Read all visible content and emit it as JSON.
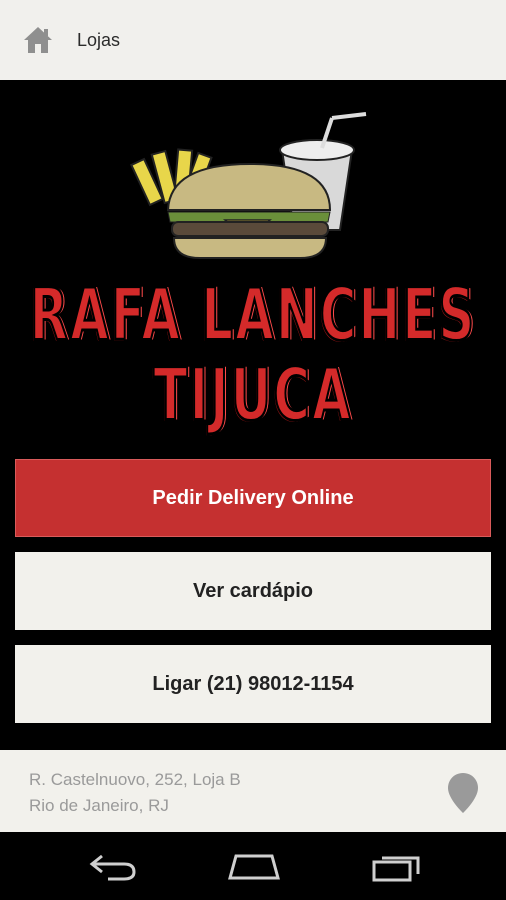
{
  "topbar": {
    "title": "Lojas",
    "icon": "home-icon"
  },
  "logo": {
    "line1": "RAFA LANCHES",
    "line2": "TIJUCA",
    "image": "burger-fries-drink-illustration"
  },
  "buttons": {
    "delivery": "Pedir Delivery Online",
    "menu": "Ver cardápio",
    "call": "Ligar (21) 98012-1154"
  },
  "address": {
    "line1": "R. Castelnuovo, 252, Loja B",
    "line2": "Rio de Janeiro, RJ",
    "icon": "map-pin-icon"
  },
  "navbar": {
    "icons": [
      "back-icon",
      "home-icon",
      "recent-apps-icon"
    ]
  },
  "colors": {
    "accent": "#c53030",
    "topbar_bg": "#f1f0ed",
    "background": "#000000"
  }
}
